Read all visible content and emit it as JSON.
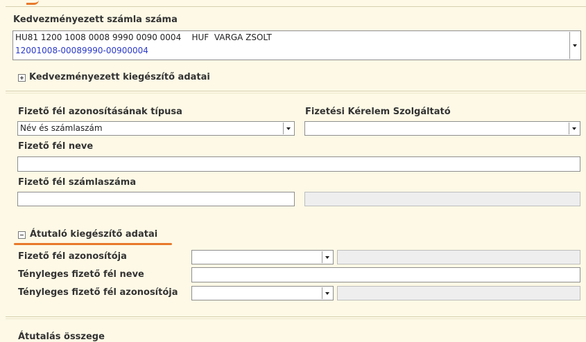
{
  "beneficiary": {
    "account_label": "Kedvezményezett számla száma",
    "account_line1": "HU81 1200 1008 0008 9990 0090 0004",
    "account_currency": "HUF",
    "account_owner": "VARGA ZSOLT",
    "account_line2": "12001008-00089990-00900004",
    "extra_label": "Kedvezményezett kiegészítő adatai"
  },
  "payer": {
    "id_type_label": "Fizető fél azonosításának típusa",
    "id_type_value": "Név és számlaszám",
    "provider_label": "Fizetési Kérelem Szolgáltató",
    "provider_value": "",
    "name_label": "Fizető fél neve",
    "name_value": "",
    "account_label": "Fizető fél számlaszáma",
    "account_value": ""
  },
  "sender_extra": {
    "section_label": "Átutaló kiegészítő adatai",
    "payer_id_label": "Fizető fél azonosítója",
    "actual_name_label": "Tényleges fizető fél neve",
    "actual_id_label": "Tényleges fizető fél azonosítója"
  },
  "amount": {
    "label": "Átutalás összege"
  },
  "colors": {
    "background": "#fdf9e6",
    "accent_orange": "#e8792b",
    "account_blue": "#2a39c8"
  }
}
